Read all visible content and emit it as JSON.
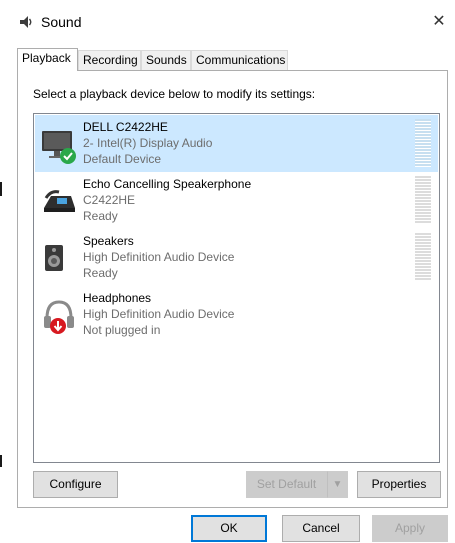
{
  "window": {
    "title": "Sound",
    "close_glyph": "✕"
  },
  "tabs": [
    {
      "label": "Playback",
      "active": true
    },
    {
      "label": "Recording",
      "active": false
    },
    {
      "label": "Sounds",
      "active": false
    },
    {
      "label": "Communications",
      "active": false
    }
  ],
  "instruction": "Select a playback device below to modify its settings:",
  "devices": [
    {
      "name": "DELL C2422HE",
      "description": "2- Intel(R) Display Audio",
      "status": "Default Device",
      "icon": "monitor-icon",
      "badge": "default-check-icon",
      "selected": true
    },
    {
      "name": "Echo Cancelling Speakerphone",
      "description": "C2422HE",
      "status": "Ready",
      "icon": "speakerphone-icon",
      "selected": false
    },
    {
      "name": "Speakers",
      "description": "High Definition Audio Device",
      "status": "Ready",
      "icon": "speaker-icon",
      "selected": false
    },
    {
      "name": "Headphones",
      "description": "High Definition Audio Device",
      "status": "Not plugged in",
      "icon": "headphones-icon",
      "badge": "unplugged-icon",
      "selected": false
    }
  ],
  "buttons": {
    "configure": "Configure",
    "set_default": "Set Default",
    "properties": "Properties",
    "ok": "OK",
    "cancel": "Cancel",
    "apply": "Apply"
  },
  "colors": {
    "selection": "#cce8ff",
    "default_badge": "#2aa84a",
    "unplugged_badge": "#d71920",
    "focus_border": "#0078d7"
  }
}
